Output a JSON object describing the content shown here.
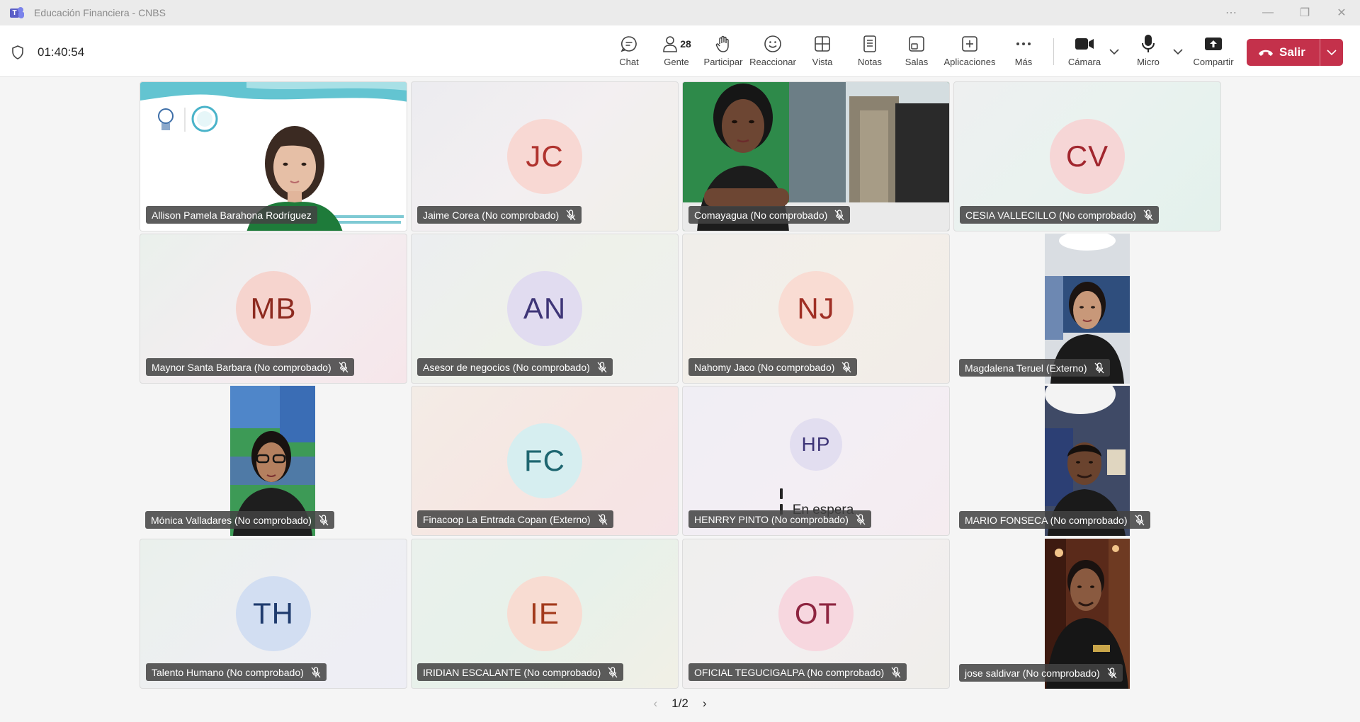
{
  "window": {
    "title": "Educación Financiera - CNBS"
  },
  "meeting": {
    "timer": "01:40:54"
  },
  "toolbar": {
    "chat": "Chat",
    "people": "Gente",
    "people_count": "28",
    "raise": "Participar",
    "react": "Reaccionar",
    "view": "Vista",
    "notes": "Notas",
    "rooms": "Salas",
    "apps": "Aplicaciones",
    "more": "Más",
    "camera": "Cámara",
    "mic": "Micro",
    "share": "Compartir",
    "leave": "Salir"
  },
  "participants": [
    {
      "name": "Allison Pamela Barahona Rodríguez",
      "type": "video"
    },
    {
      "name": "Jaime Corea (No comprobado)",
      "initials": "JC",
      "type": "avatar"
    },
    {
      "name": "Comayagua (No comprobado)",
      "type": "video"
    },
    {
      "name": "CESIA VALLECILLO (No comprobado)",
      "initials": "CV",
      "type": "avatar"
    },
    {
      "name": "Maynor Santa Barbara (No comprobado)",
      "initials": "MB",
      "type": "avatar"
    },
    {
      "name": "Asesor de negocios (No comprobado)",
      "initials": "AN",
      "type": "avatar"
    },
    {
      "name": "Nahomy Jaco (No comprobado)",
      "initials": "NJ",
      "type": "avatar"
    },
    {
      "name": "Magdalena Teruel (Externo)",
      "type": "video"
    },
    {
      "name": "Mónica Valladares (No comprobado)",
      "type": "video"
    },
    {
      "name": "Finacoop La Entrada Copan (Externo)",
      "initials": "FC",
      "type": "avatar"
    },
    {
      "name": "HENRRY PINTO (No comprobado)",
      "initials": "HP",
      "type": "avatar",
      "status": "En espera"
    },
    {
      "name": "MARIO FONSECA (No comprobado)",
      "type": "video"
    },
    {
      "name": "Talento Humano (No comprobado)",
      "initials": "TH",
      "type": "avatar"
    },
    {
      "name": "IRIDIAN ESCALANTE (No comprobado)",
      "initials": "IE",
      "type": "avatar"
    },
    {
      "name": "OFICIAL TEGUCIGALPA (No comprobado)",
      "initials": "OT",
      "type": "avatar"
    },
    {
      "name": "jose saldivar (No comprobado)",
      "type": "video"
    }
  ],
  "pager": {
    "label": "1/2"
  },
  "colors": {
    "leave": "#c4314b",
    "teams_brand": "#5b5fc7"
  }
}
